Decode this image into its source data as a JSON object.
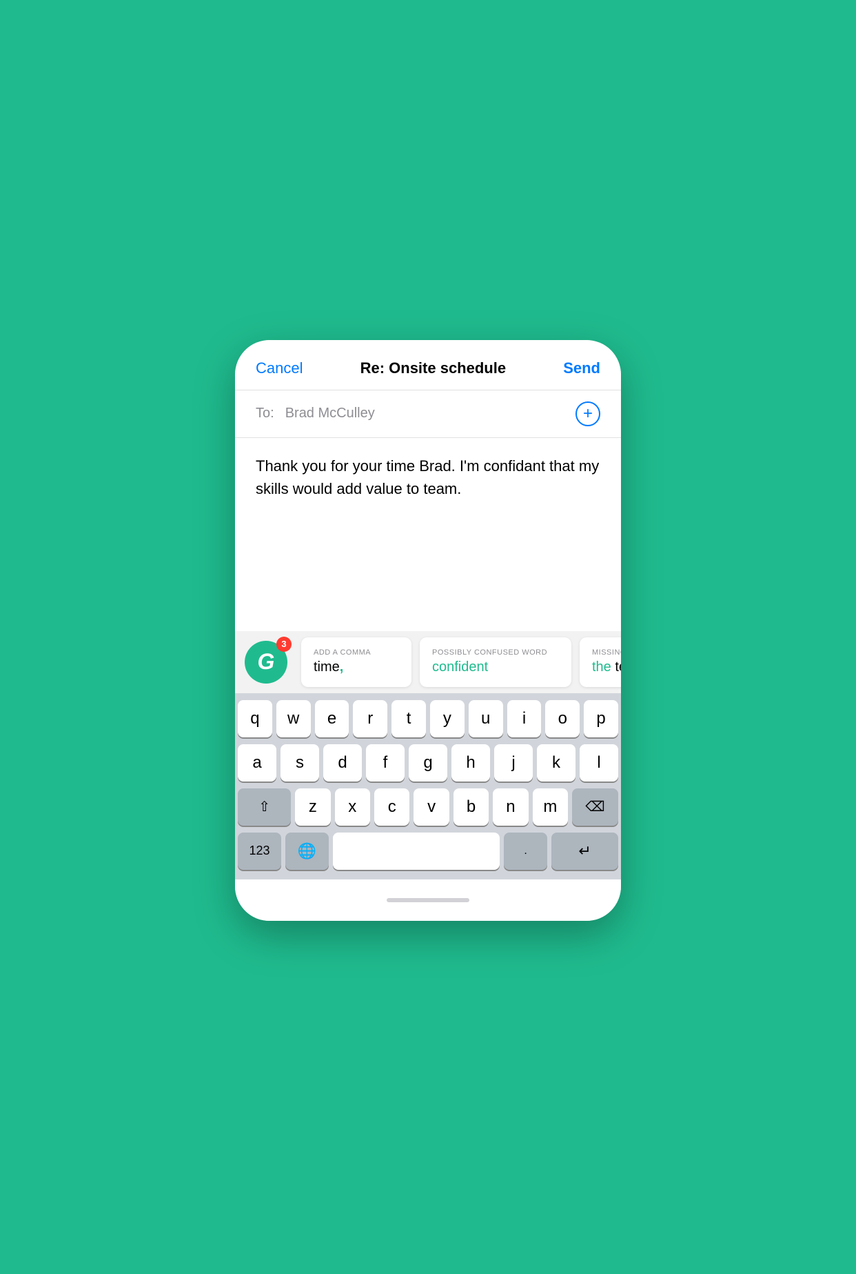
{
  "header": {
    "cancel_label": "Cancel",
    "title": "Re: Onsite schedule",
    "send_label": "Send"
  },
  "to_field": {
    "label": "To:",
    "recipient": "Brad McCulley"
  },
  "body": {
    "text": "Thank you for your time Brad. I'm confidant that my skills would add value to team."
  },
  "grammarly": {
    "badge_count": "3"
  },
  "suggestions": [
    {
      "label": "ADD A COMMA",
      "value": "time,",
      "type": "comma"
    },
    {
      "label": "POSSIBLY CONFUSED WORD",
      "value": "confident",
      "type": "confused"
    },
    {
      "label": "MISSING",
      "value": "the te",
      "type": "missing"
    }
  ],
  "keyboard": {
    "rows": [
      [
        "q",
        "w",
        "e",
        "r",
        "t",
        "y",
        "u",
        "i",
        "o",
        "p"
      ],
      [
        "a",
        "s",
        "d",
        "f",
        "g",
        "h",
        "j",
        "k",
        "l"
      ],
      [
        "z",
        "x",
        "c",
        "v",
        "b",
        "n",
        "m"
      ]
    ],
    "shift_label": "⇧",
    "delete_label": "⌫",
    "num_label": "123",
    "globe_label": "🌐",
    "period_label": ".",
    "return_label": "↵"
  }
}
